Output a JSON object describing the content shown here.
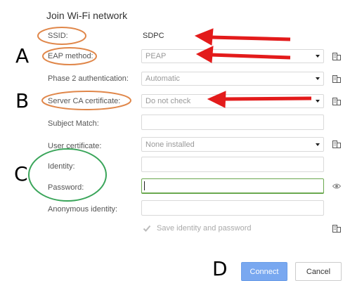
{
  "dialog": {
    "title": "Join Wi-Fi network"
  },
  "form": {
    "ssid_label": "SSID:",
    "ssid_value": "SDPC",
    "eap_label": "EAP method:",
    "eap_value": "PEAP",
    "phase2_label": "Phase 2 authentication:",
    "phase2_value": "Automatic",
    "server_ca_label": "Server CA certificate:",
    "server_ca_value": "Do not check",
    "subject_match_label": "Subject Match:",
    "subject_match_value": "",
    "user_cert_label": "User certificate:",
    "user_cert_value": "None installed",
    "identity_label": "Identity:",
    "identity_value": "",
    "password_label": "Password:",
    "password_value": "",
    "anon_identity_label": "Anonymous identity:",
    "anon_identity_value": "",
    "save_label": "Save identity and password",
    "save_checked": true
  },
  "buttons": {
    "connect": "Connect",
    "cancel": "Cancel"
  },
  "annotations": {
    "letters": [
      "A",
      "B",
      "C",
      "D"
    ],
    "arrow_color": "#e31b1b",
    "circle_orange": "#e0874a",
    "circle_green": "#3aa55a"
  },
  "icons": {
    "policy": "building-policy-icon",
    "eye": "show-password-eye-icon",
    "caret": "dropdown-caret-icon",
    "checkbox": "checkmark-icon"
  },
  "colors": {
    "connect_bg": "#79a8f0",
    "focused_border": "#6aa84f"
  }
}
